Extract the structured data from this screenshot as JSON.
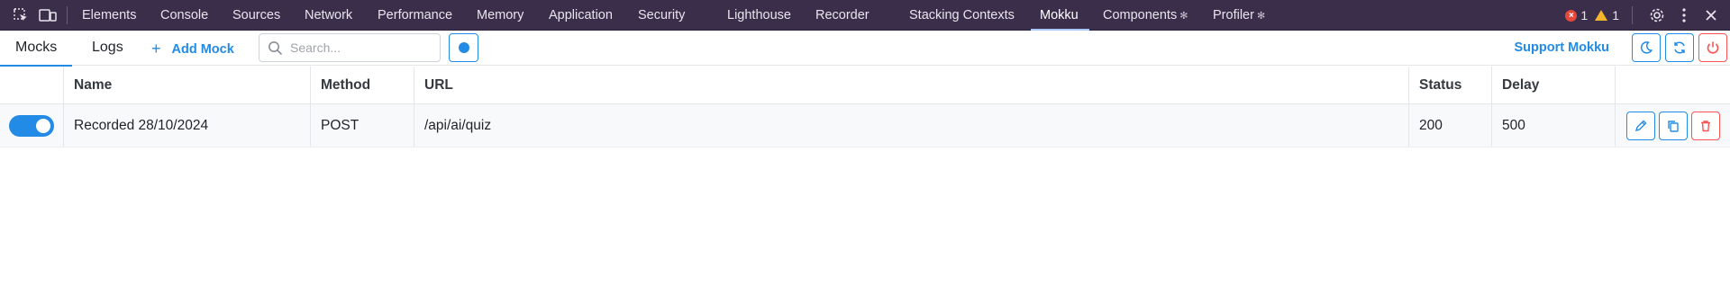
{
  "devtools": {
    "tabs": [
      {
        "label": "Elements"
      },
      {
        "label": "Console"
      },
      {
        "label": "Sources"
      },
      {
        "label": "Network"
      },
      {
        "label": "Performance"
      },
      {
        "label": "Memory"
      },
      {
        "label": "Application"
      },
      {
        "label": "Security"
      },
      {
        "label": "Lighthouse"
      },
      {
        "label": "Recorder"
      },
      {
        "label": "Stacking Contexts"
      },
      {
        "label": "Mokku",
        "active": true
      },
      {
        "label": "Components"
      },
      {
        "label": "Profiler"
      }
    ],
    "error_count": "1",
    "warning_count": "1"
  },
  "mokku": {
    "tabs": [
      {
        "label": "Mocks",
        "active": true
      },
      {
        "label": "Logs"
      }
    ],
    "add_mock_label": "Add Mock",
    "search_placeholder": "Search...",
    "search_value": "",
    "support_label": "Support Mokku",
    "colors": {
      "accent": "#228be6",
      "danger": "#fa5252",
      "devtools_bg": "#3b2e4a"
    }
  },
  "table": {
    "columns": [
      "",
      "Name",
      "Method",
      "URL",
      "Status",
      "Delay",
      ""
    ],
    "rows": [
      {
        "active": true,
        "name": "Recorded 28/10/2024",
        "method": "POST",
        "url": "/api/ai/quiz",
        "status": "200",
        "delay": "500"
      }
    ]
  }
}
